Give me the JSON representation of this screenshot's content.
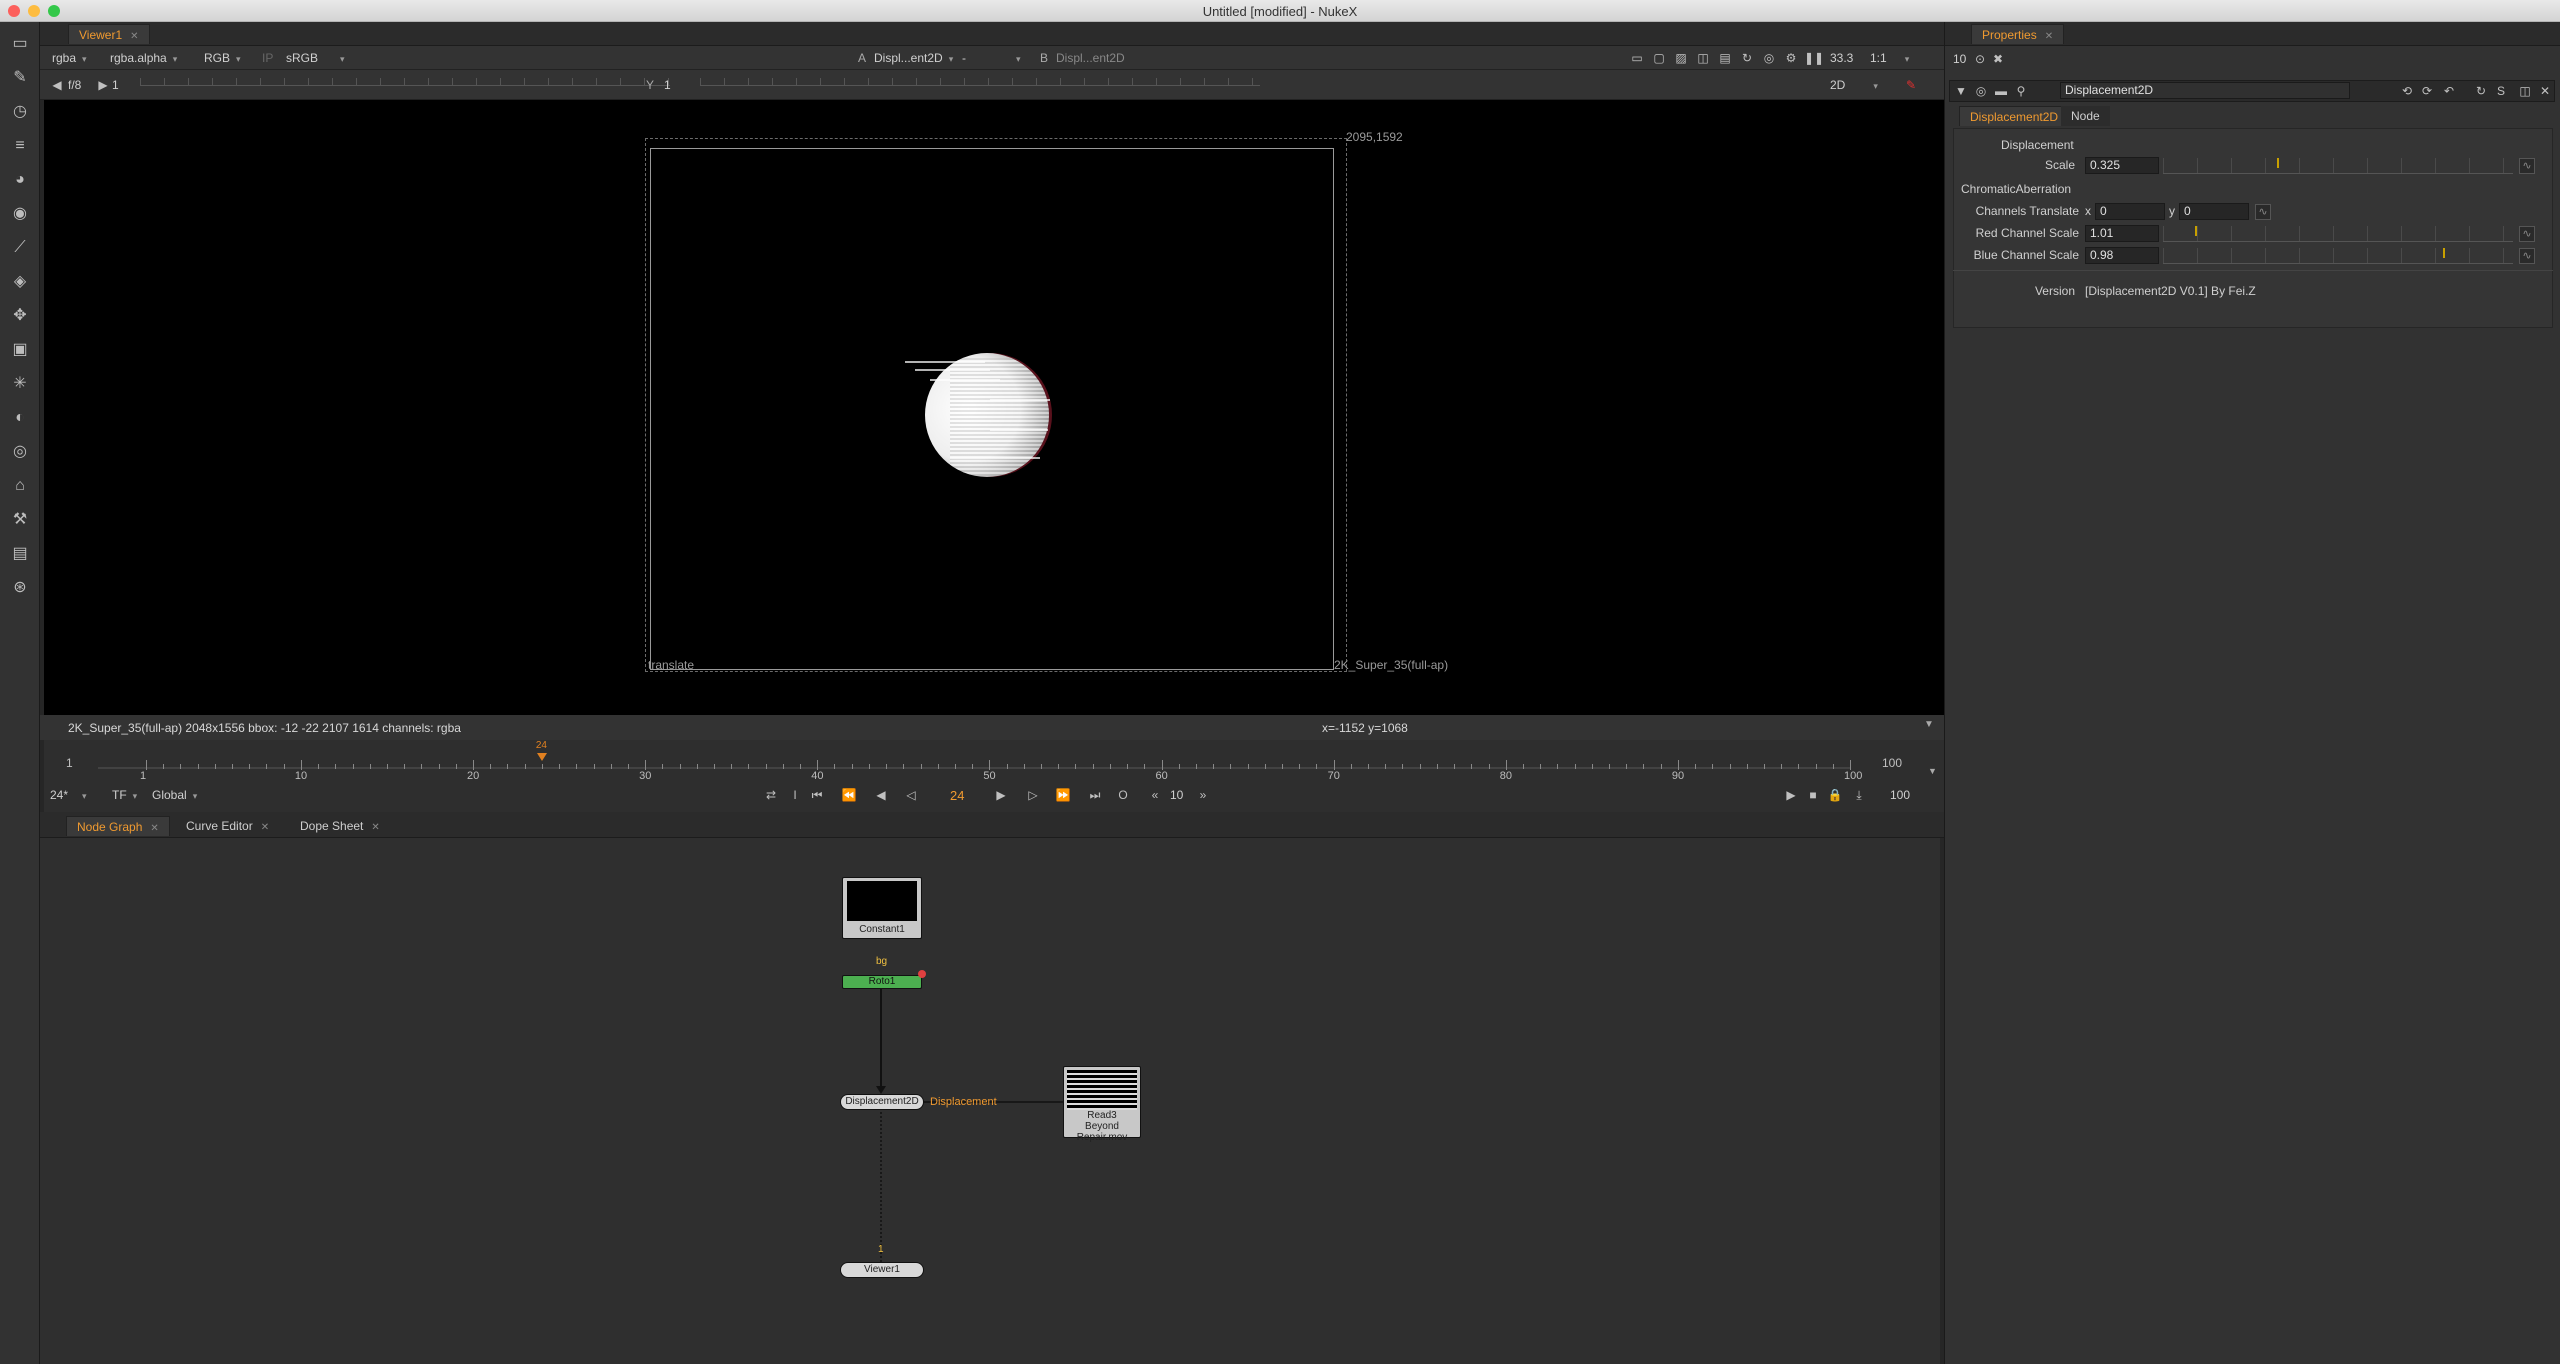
{
  "window": {
    "title": "Untitled [modified] - NukeX"
  },
  "viewer": {
    "tab_label": "Viewer1",
    "channels": "rgba",
    "alpha_channel": "rgba.alpha",
    "display_channels": "RGB",
    "ip_label": "IP",
    "lut": "sRGB",
    "a_label": "A",
    "a_input": "Displ...ent2D",
    "wipe_mode": "-",
    "b_label": "B",
    "b_input": "Displ...ent2D",
    "zoom": "33.3",
    "scale": "1:1",
    "fstop": "f/8",
    "frame_field": "1",
    "y_label": "Y",
    "y_field": "1",
    "view_mode": "2D",
    "corner_label": "2095,1592",
    "format_label": "2K_Super_35(full-ap)",
    "translate_label": "translate",
    "status_info": "2K_Super_35(full-ap) 2048x1556  bbox: -12 -22 2107 1614 channels: rgba",
    "coords": "x=-1152 y=1068"
  },
  "timeline": {
    "start": "1",
    "end": "100",
    "ticks": [
      "1",
      "10",
      "20",
      "30",
      "40",
      "50",
      "60",
      "70",
      "80",
      "90",
      "100"
    ],
    "current_frame": "24",
    "fps": "24*",
    "tf": "TF",
    "global": "Global",
    "step": "10",
    "end_field": "100",
    "in_label": "I",
    "out_label": "O"
  },
  "node_graph": {
    "tabs": [
      {
        "label": "Node Graph"
      },
      {
        "label": "Curve Editor"
      },
      {
        "label": "Dope Sheet"
      }
    ],
    "nodes": {
      "constant": "Constant1",
      "bg_label": "bg",
      "roto": "Roto1",
      "displacement": "Displacement2D",
      "displacement_edge": "Displacement",
      "read": "Read3",
      "read_file": "Beyond Repair.mov",
      "viewer": "Viewer1",
      "viewer_input": "1"
    }
  },
  "properties": {
    "tab_label": "Properties",
    "max_panels": "10",
    "node_name": "Displacement2D",
    "tabs": [
      "Displacement2D",
      "Node"
    ],
    "section_displacement": "Displacement",
    "scale_label": "Scale",
    "scale_value": "0.325",
    "scale_fraction": 0.325,
    "section_ca": "ChromaticAberration",
    "channels_translate_label": "Channels Translate",
    "x_label": "x",
    "x_value": "0",
    "y_label": "y",
    "y_value": "0",
    "red_label": "Red Channel Scale",
    "red_value": "1.01",
    "blue_label": "Blue Channel Scale",
    "blue_value": "0.98",
    "version_label": "Version",
    "version_value": "[Displacement2D V0.1]  By Fei.Z"
  },
  "colors": {
    "accent": "#f09a30",
    "roto_node": "#4caf50",
    "frame_marker": "#e08020"
  }
}
